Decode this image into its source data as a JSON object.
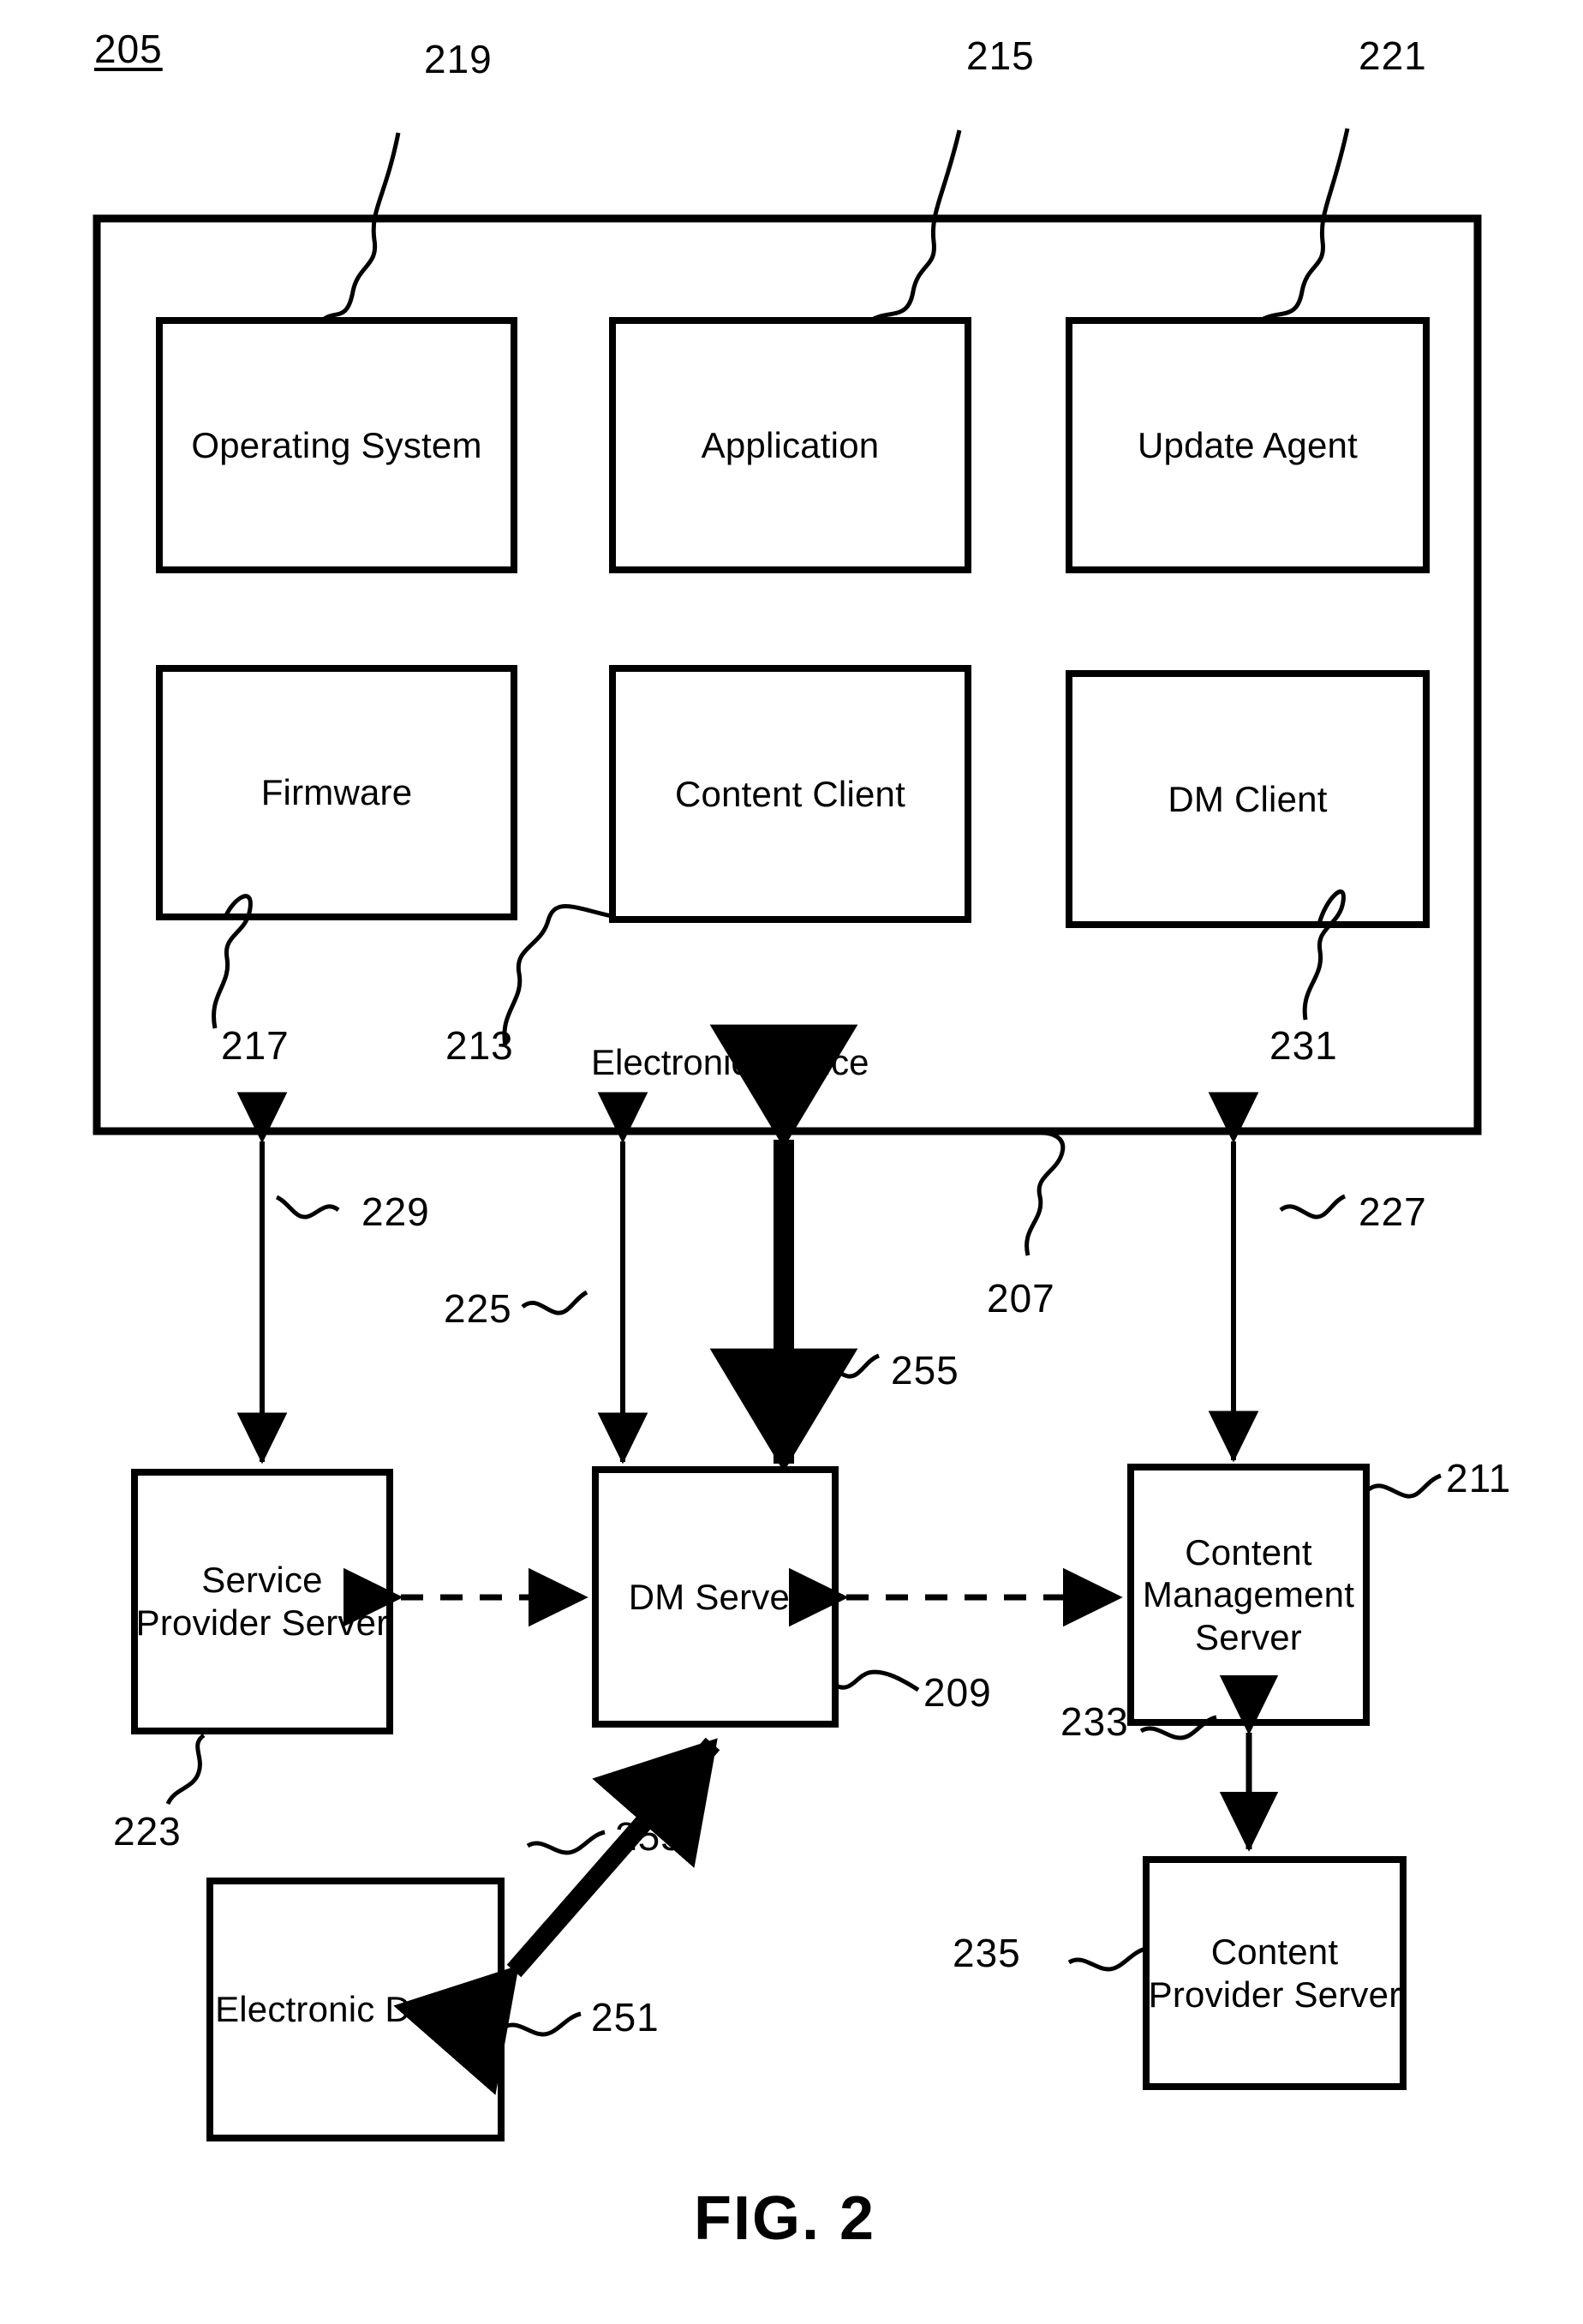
{
  "figure": {
    "caption": "FIG. 2",
    "top_reference": "205"
  },
  "device_container": {
    "label": "Electronic Device",
    "reference": "207",
    "modules": [
      {
        "label": "Operating System",
        "reference": "219"
      },
      {
        "label": "Application",
        "reference": "215"
      },
      {
        "label": "Update Agent",
        "reference": "221"
      },
      {
        "label": "Firmware",
        "reference": "217"
      },
      {
        "label": "Content Client",
        "reference": "213"
      },
      {
        "label": "DM Client",
        "reference": "231"
      }
    ]
  },
  "nodes": [
    {
      "label": "Service Provider Server",
      "reference": "223"
    },
    {
      "label": "DM Server",
      "reference": "209"
    },
    {
      "label": "Content Management Server",
      "reference": "211"
    },
    {
      "label": "Content Provider Server",
      "reference": "235"
    },
    {
      "label": "Electronic Device",
      "reference": "251"
    }
  ],
  "connections": [
    {
      "reference": "229",
      "from": "Electronic Device",
      "to": "Service Provider Server",
      "style": "double-arrow-thin"
    },
    {
      "reference": "225",
      "from": "Electronic Device",
      "to": "DM Server",
      "style": "double-arrow-thin"
    },
    {
      "reference": "255",
      "from": "Electronic Device",
      "to": "DM Server",
      "style": "double-arrow-bold"
    },
    {
      "reference": "227",
      "from": "Electronic Device",
      "to": "Content Management Server",
      "style": "double-arrow-thin"
    },
    {
      "reference": "233",
      "from": "Content Management Server",
      "to": "Content Provider Server",
      "style": "double-arrow-thin"
    },
    {
      "reference": "255",
      "from": "Electronic Device",
      "to": "DM Server",
      "style": "double-arrow-bold"
    }
  ],
  "reference_numerals": {
    "n205": "205",
    "n219": "219",
    "n215": "215",
    "n221": "221",
    "n217": "217",
    "n213": "213",
    "n231": "231",
    "n229": "229",
    "n225": "225",
    "n255a": "255",
    "n207": "207",
    "n227": "227",
    "n211": "211",
    "n209": "209",
    "n223": "223",
    "n233": "233",
    "n235": "235",
    "n251": "251",
    "n255b": "255"
  },
  "labels": {
    "operating_system": "Operating System",
    "application": "Application",
    "update_agent": "Update Agent",
    "firmware": "Firmware",
    "content_client": "Content Client",
    "dm_client": "DM Client",
    "electronic_device_top": "Electronic Device",
    "service_provider_server": "Service Provider Server",
    "dm_server": "DM Server",
    "content_management_server": "Content Management Server",
    "content_provider_server": "Content Provider Server",
    "electronic_device_bottom": "Electronic Device",
    "fig": "FIG. 2"
  },
  "colors": {
    "ink": "#000000",
    "paper": "#ffffff"
  }
}
